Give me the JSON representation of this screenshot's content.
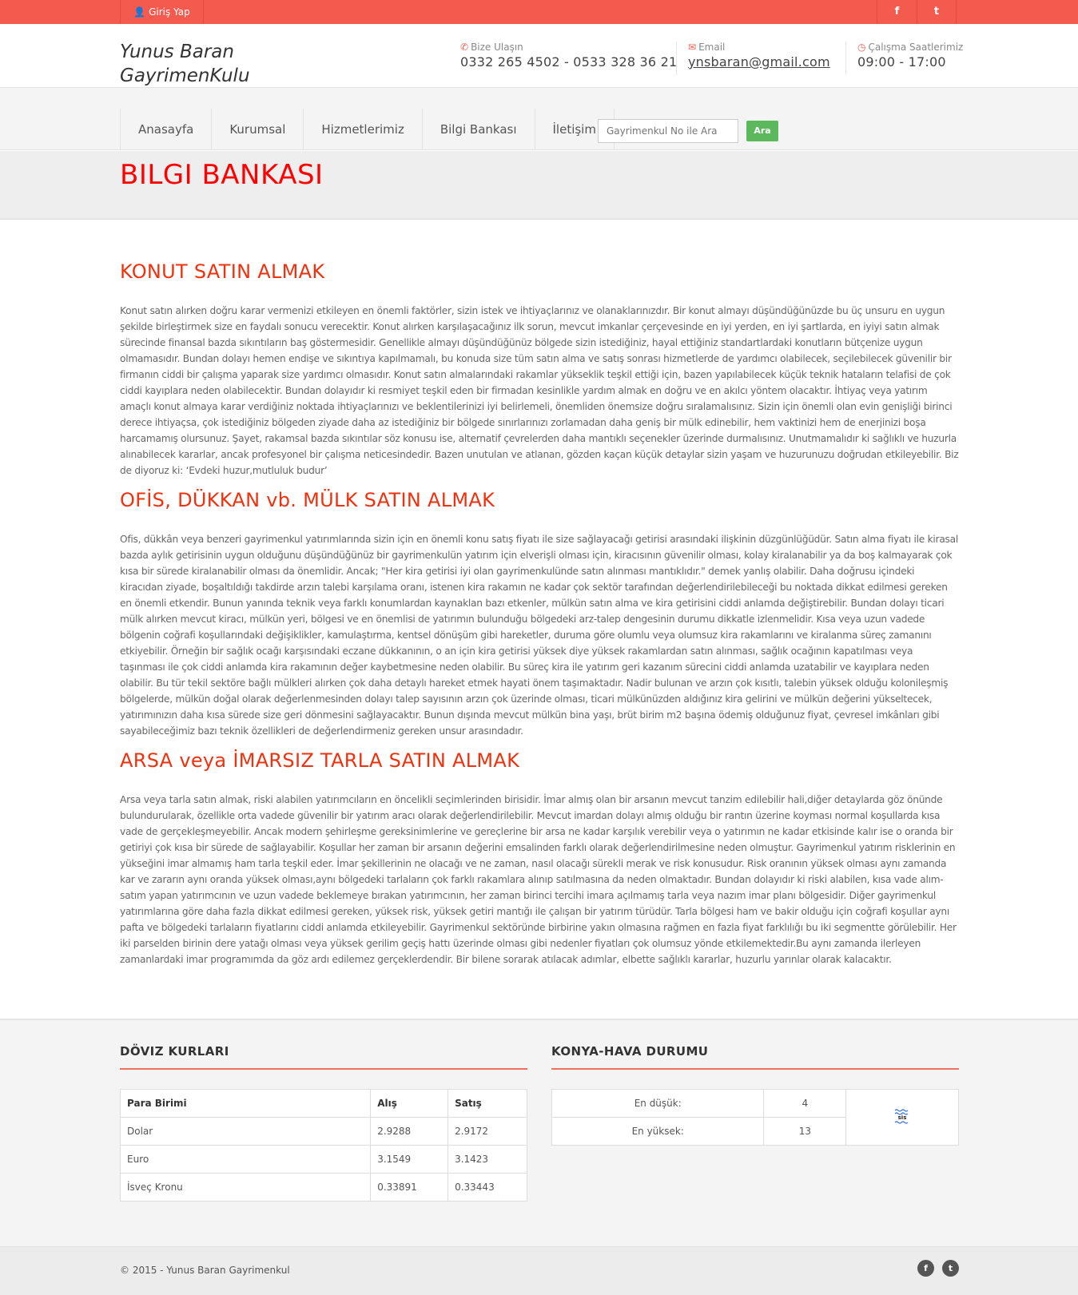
{
  "topbar": {
    "login_label": "Giriş Yap",
    "facebook_glyph": "f",
    "twitter_glyph": "t"
  },
  "header": {
    "logo": "Yunus Baran GayrimenKulu",
    "contact_label": "Bize Ulaşın",
    "phone": "0332 265 4502 - 0533 328 36 21",
    "email_label": "Email",
    "email": "ynsbaran@gmail.com",
    "hours_label": "Çalışma Saatlerimiz",
    "hours": "09:00 - 17:00"
  },
  "nav": {
    "items": [
      "Anasayfa",
      "Kurumsal",
      "Hizmetlerimiz",
      "Bilgi Bankası",
      "İletişim"
    ],
    "search_placeholder": "Gayrimenkul No ile Ara",
    "search_button": "Ara"
  },
  "page_title": "BILGI BANKASI",
  "sections": [
    {
      "heading": "KONUT SATIN ALMAK",
      "body": "Konut satın alırken doğru karar vermenizi etkileyen en önemli faktörler, sizin istek ve ihtiyaçlarınız ve olanaklarınızdır. Bir konut almayı düşündüğünüzde bu üç unsuru en uygun şekilde birleştirmek size en faydalı sonucu verecektir. Konut alırken karşılaşacağınız ilk sorun, mevcut imkanlar çerçevesinde en iyi yerden, en iyi şartlarda, en iyiyi satın almak sürecinde finansal bazda sıkıntıların baş göstermesidir. Genellikle almayı düşündüğünüz bölgede sizin istediğiniz, hayal ettiğiniz standartlardaki konutların bütçenize uygun olmamasıdır. Bundan dolayı hemen endişe ve sıkıntıya kapılmamalı, bu konuda size tüm satın alma ve satış sonrası hizmetlerde de yardımcı olabilecek, seçilebilecek güvenilir bir firmanın ciddi bir çalışma yaparak size yardımcı olmasıdır. Konut satın almalarındaki rakamlar yükseklik teşkil ettiği için, bazen yapılabilecek küçük teknik hataların telafisi de çok ciddi kayıplara neden olabilecektir. Bundan dolayıdır ki resmiyet teşkil eden bir firmadan kesinlikle yardım almak en doğru ve en akılcı yöntem olacaktır. İhtiyaç veya yatırım amaçlı konut almaya karar verdiğiniz noktada ihtiyaçlarınızı ve beklentilerinizi iyi belirlemeli, önemliden önemsize doğru sıralamalısınız. Sizin için önemli olan evin genişliği birinci derece ihtiyaçsa, çok istediğiniz bölgeden ziyade daha az istediğiniz bir bölgede sınırlarınızı zorlamadan daha geniş bir mülk edinebilir, hem vaktinizi hem de enerjinizi boşa harcamamış olursunuz. Şayet, rakamsal bazda sıkıntılar söz konusu ise, alternatif çevrelerden daha mantıklı seçenekler üzerinde durmalısınız. Unutmamalıdır ki sağlıklı ve huzurla alınabilecek kararlar, ancak profesyonel bir çalışma neticesindedir. Bazen unutulan ve atlanan, gözden kaçan küçük detaylar sizin yaşam ve huzurunuzu doğrudan etkileyebilir. Biz de diyoruz ki: ‘Evdeki huzur,mutluluk budur’"
    },
    {
      "heading": "OFİS, DÜKKAN vb. MÜLK SATIN ALMAK",
      "body": "Ofis, dükkân veya benzeri gayrimenkul yatırımlarında sizin için en önemli konu satış fiyatı ile size sağlayacağı getirisi arasındaki ilişkinin düzgünlüğüdür. Satın alma fiyatı ile kirasal bazda aylık getirisinin uygun olduğunu düşündüğünüz bir gayrimenkulün yatırım için elverişli olması için, kiracısının güvenilir olması, kolay kiralanabilir ya da boş kalmayarak çok kısa bir sürede kiralanabilir olması da önemlidir. Ancak; \"Her kira getirisi iyi olan gayrimenkulünde satın alınması mantıklıdır.\" demek yanlış olabilir. Daha doğrusu içindeki kiracıdan ziyade, boşaltıldığı takdirde arzın talebi karşılama oranı, istenen kira rakamın ne kadar çok sektör tarafından değerlendirilebileceği bu noktada dikkat edilmesi gereken en önemli etkendir. Bunun yanında teknik veya farklı konumlardan kaynaklan bazı etkenler, mülkün satın alma ve kira getirisini ciddi anlamda değiştirebilir. Bundan dolayı ticari mülk alırken mevcut kiracı, mülkün yeri, bölgesi ve en önemlisi de yatırımın bulunduğu bölgedeki arz-talep dengesinin durumu dikkatle izlenmelidir. Kısa veya uzun vadede bölgenin coğrafi koşullarındaki değişiklikler, kamulaştırma, kentsel dönüşüm gibi hareketler, duruma göre olumlu veya olumsuz kira rakamlarını ve kiralanma süreç zamanını etkiyebilir. Örneğin bir sağlık ocağı karşısındaki eczane dükkanının, o an için kira getirisi yüksek diye yüksek rakamlardan satın alınması, sağlık ocağının kapatılması veya taşınması ile çok ciddi anlamda kira rakamının değer kaybetmesine neden olabilir. Bu süreç kira ile yatırım geri kazanım sürecini ciddi anlamda uzatabilir ve kayıplara neden olabilir. Bu tür tekil sektöre bağlı mülkleri alırken çok daha detaylı hareket etmek hayati önem taşımaktadır. Nadir bulunan ve arzın çok kısıtlı, talebin yüksek olduğu kolonileşmiş bölgelerde, mülkün doğal olarak değerlenmesinden dolayı talep sayısının arzın çok üzerinde olması, ticari mülkünüzden aldığınız kira gelirini ve mülkün değerini yükseltecek, yatırımınızın daha kısa sürede size geri dönmesini sağlayacaktır. Bunun dışında mevcut mülkün bina yaşı, brüt birim m2 başına ödemiş olduğunuz fiyat, çevresel imkânları gibi sayabileceğimiz bazı teknik özellikleri de değerlendirmeniz gereken unsur arasındadır."
    },
    {
      "heading": "ARSA veya İMARSIZ TARLA SATIN ALMAK",
      "body": "Arsa veya tarla satın almak, riski alabilen yatırımcıların en öncelikli seçimlerinden birisidir. İmar almış olan bir arsanın mevcut tanzim edilebilir hali,diğer detaylarda göz önünde bulundurularak, özellikle orta vadede güvenilir bir yatırım aracı olarak değerlendirilebilir. Mevcut imardan dolayı almış olduğu bir rantın üzerine koyması normal koşullarda kısa vade de gerçekleşmeyebilir. Ancak modern şehirleşme gereksinimlerine ve gereçlerine bir arsa ne kadar karşılık verebilir veya o yatırımın ne kadar etkisinde kalır ise o oranda bir getiriyi çok kısa bir sürede de sağlayabilir. Koşullar her zaman bir arsanın değerini emsalinden farklı olarak değerlendirilmesine neden olmuştur. Gayrimenkul yatırım risklerinin en yükseğini imar almamış ham tarla teşkil eder. İmar şekillerinin ne olacağı ve ne zaman, nasıl olacağı sürekli merak ve risk konusudur. Risk oranının yüksek olması aynı zamanda kar ve zararın aynı oranda yüksek olması,aynı bölgedeki tarlaların çok farklı rakamlara alınıp satılmasına da neden olmaktadır. Bundan dolayıdır ki riski alabilen, kısa vade alım-satım yapan yatırımcının ve uzun vadede beklemeye bırakan yatırımcının, her zaman birinci tercihi imara açılmamış tarla veya nazım imar planı bölgesidir. Diğer gayrimenkul yatırımlarına göre daha fazla dikkat edilmesi gereken, yüksek risk, yüksek getiri mantığı ile çalışan bir yatırım türüdür. Tarla bölgesi ham ve bakir olduğu için coğrafi koşullar aynı pafta ve bölgedeki tarlaların fiyatlarını ciddi anlamda etkileyebilir. Gayrimenkul sektöründe birbirine yakın olmasına rağmen en fazla fiyat farklılığı bu iki segmentte görülebilir. Her iki parselden birinin dere yatağı olması veya yüksek gerilim geçiş hattı üzerinde olması gibi nedenler fiyatları çok olumsuz yönde etkilemektedir.Bu aynı zamanda ilerleyen zamanlardaki imar programımda da göz ardı edilemez gerçeklerdendir. Bir bilene sorarak atılacak adımlar, elbette sağlıklı kararlar, huzurlu yarınlar olarak kalacaktır."
    }
  ],
  "currency": {
    "title": "DÖVIZ KURLARI",
    "headers": [
      "Para Birimi",
      "Alış",
      "Satış"
    ],
    "rows": [
      [
        "Dolar",
        "2.9288",
        "2.9172"
      ],
      [
        "Euro",
        "3.1549",
        "3.1423"
      ],
      [
        "İsveç Kronu",
        "0.33891",
        "0.33443"
      ]
    ]
  },
  "weather": {
    "title": "KONYA-HAVA DURUMU",
    "min_label": "En düşük:",
    "min_value": "4",
    "max_label": "En yüksek:",
    "max_value": "13",
    "icon_text": "sis"
  },
  "footer": {
    "copyright": "© 2015 - Yunus Baran Gayrimenkul",
    "facebook_glyph": "f",
    "twitter_glyph": "t"
  },
  "colors": {
    "accent": "#f55a4e",
    "title_red": "#ff0000",
    "heading_red": "#f0310e",
    "button_green": "#5cb85c"
  }
}
